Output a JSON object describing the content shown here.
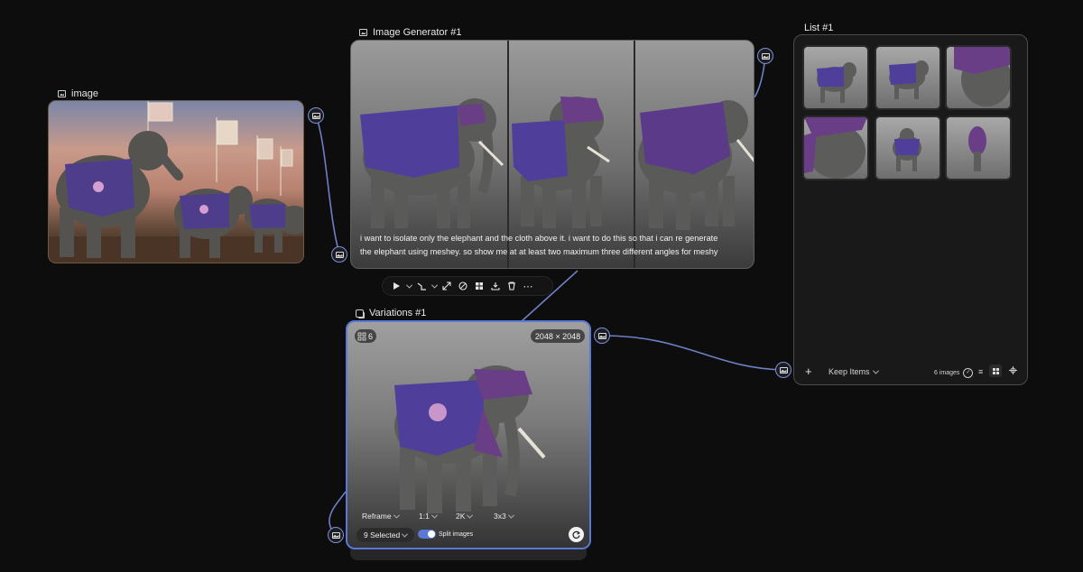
{
  "image_node": {
    "title": "image"
  },
  "generator_node": {
    "title": "Image Generator #1",
    "prompt_line1": "i want to isolate only the elephant and the cloth above it. i want to do this so that i can re generate",
    "prompt_line2": "the elephant using meshey.  so show me at at least two maximum three different angles for meshy"
  },
  "toolbar": {
    "items": [
      "play-icon",
      "chevron-down-icon",
      "route-icon",
      "chevron-down-icon",
      "expand-icon",
      "mask-icon",
      "grid-icon",
      "download-icon",
      "trash-icon",
      "more-icon"
    ]
  },
  "variations_node": {
    "title": "Variations #1",
    "count": "6",
    "resolution": "2048 × 2048",
    "reframe_label": "Reframe",
    "ratio": "1:1",
    "quality": "2K",
    "grid": "3x3",
    "selected_label": "9 Selected",
    "split_label": "Split images",
    "split_on": true
  },
  "list_node": {
    "title": "List #1",
    "keep_label": "Keep Items",
    "count_label": "6 images"
  },
  "colors": {
    "accent": "#5a79d6",
    "bg": "#0d0d0d",
    "cloth": "#6a4fa8"
  }
}
